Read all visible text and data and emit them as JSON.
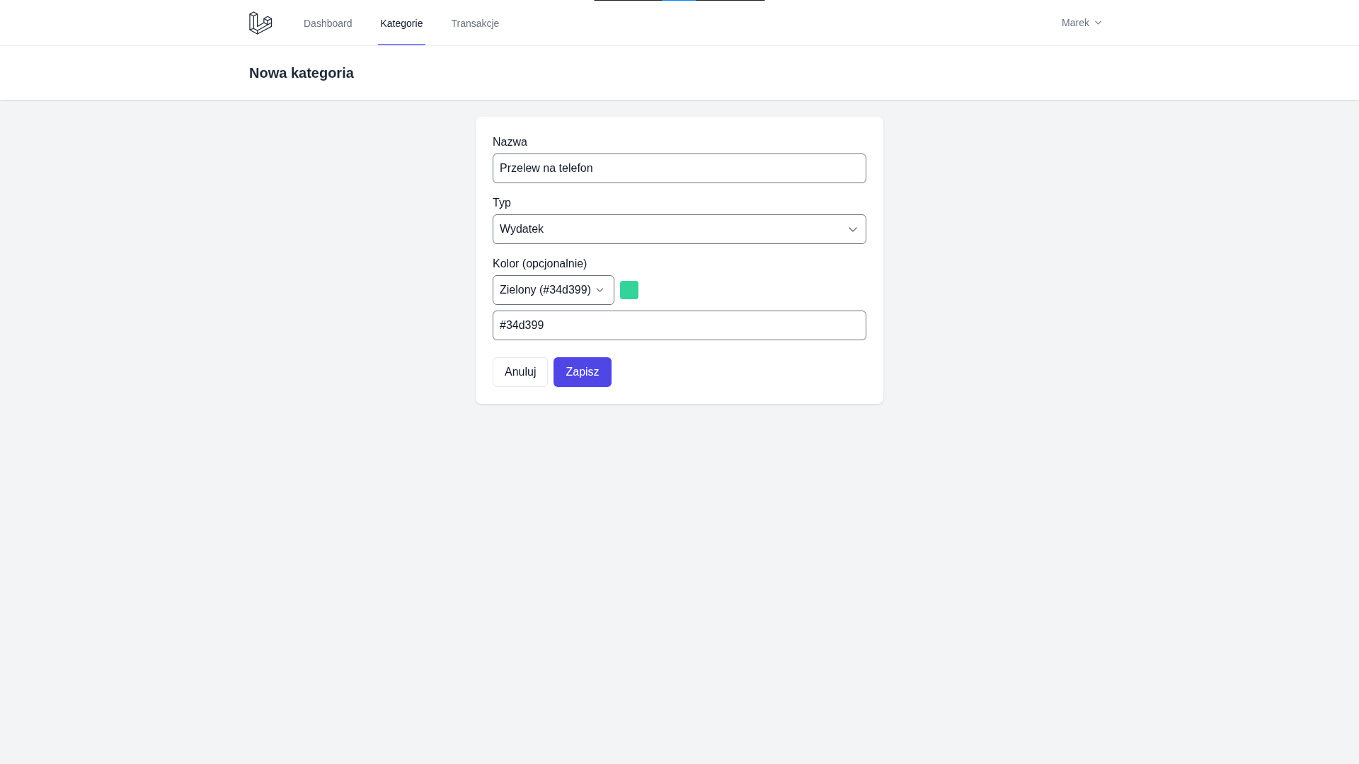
{
  "nav": {
    "items": [
      {
        "label": "Dashboard",
        "selected": false
      },
      {
        "label": "Kategorie",
        "selected": true
      },
      {
        "label": "Transakcje",
        "selected": false
      }
    ],
    "user_menu": {
      "label": "Marek"
    }
  },
  "header": {
    "title": "Nowa kategoria"
  },
  "form": {
    "fields": [
      {
        "kind": "text",
        "label": "Nazwa",
        "value": "Przelew na telefon"
      },
      {
        "kind": "select",
        "label": "Typ",
        "value": "Wydatek"
      },
      {
        "kind": "color",
        "label": "Kolor (opcjonalnie)",
        "value": "Zielony (#34d399)",
        "color": "#34d399",
        "hex_value": "#34d399"
      }
    ],
    "buttons": [
      {
        "kind": "secondary",
        "label": "Anuluj"
      },
      {
        "kind": "primary",
        "label": "Zapisz"
      }
    ]
  }
}
